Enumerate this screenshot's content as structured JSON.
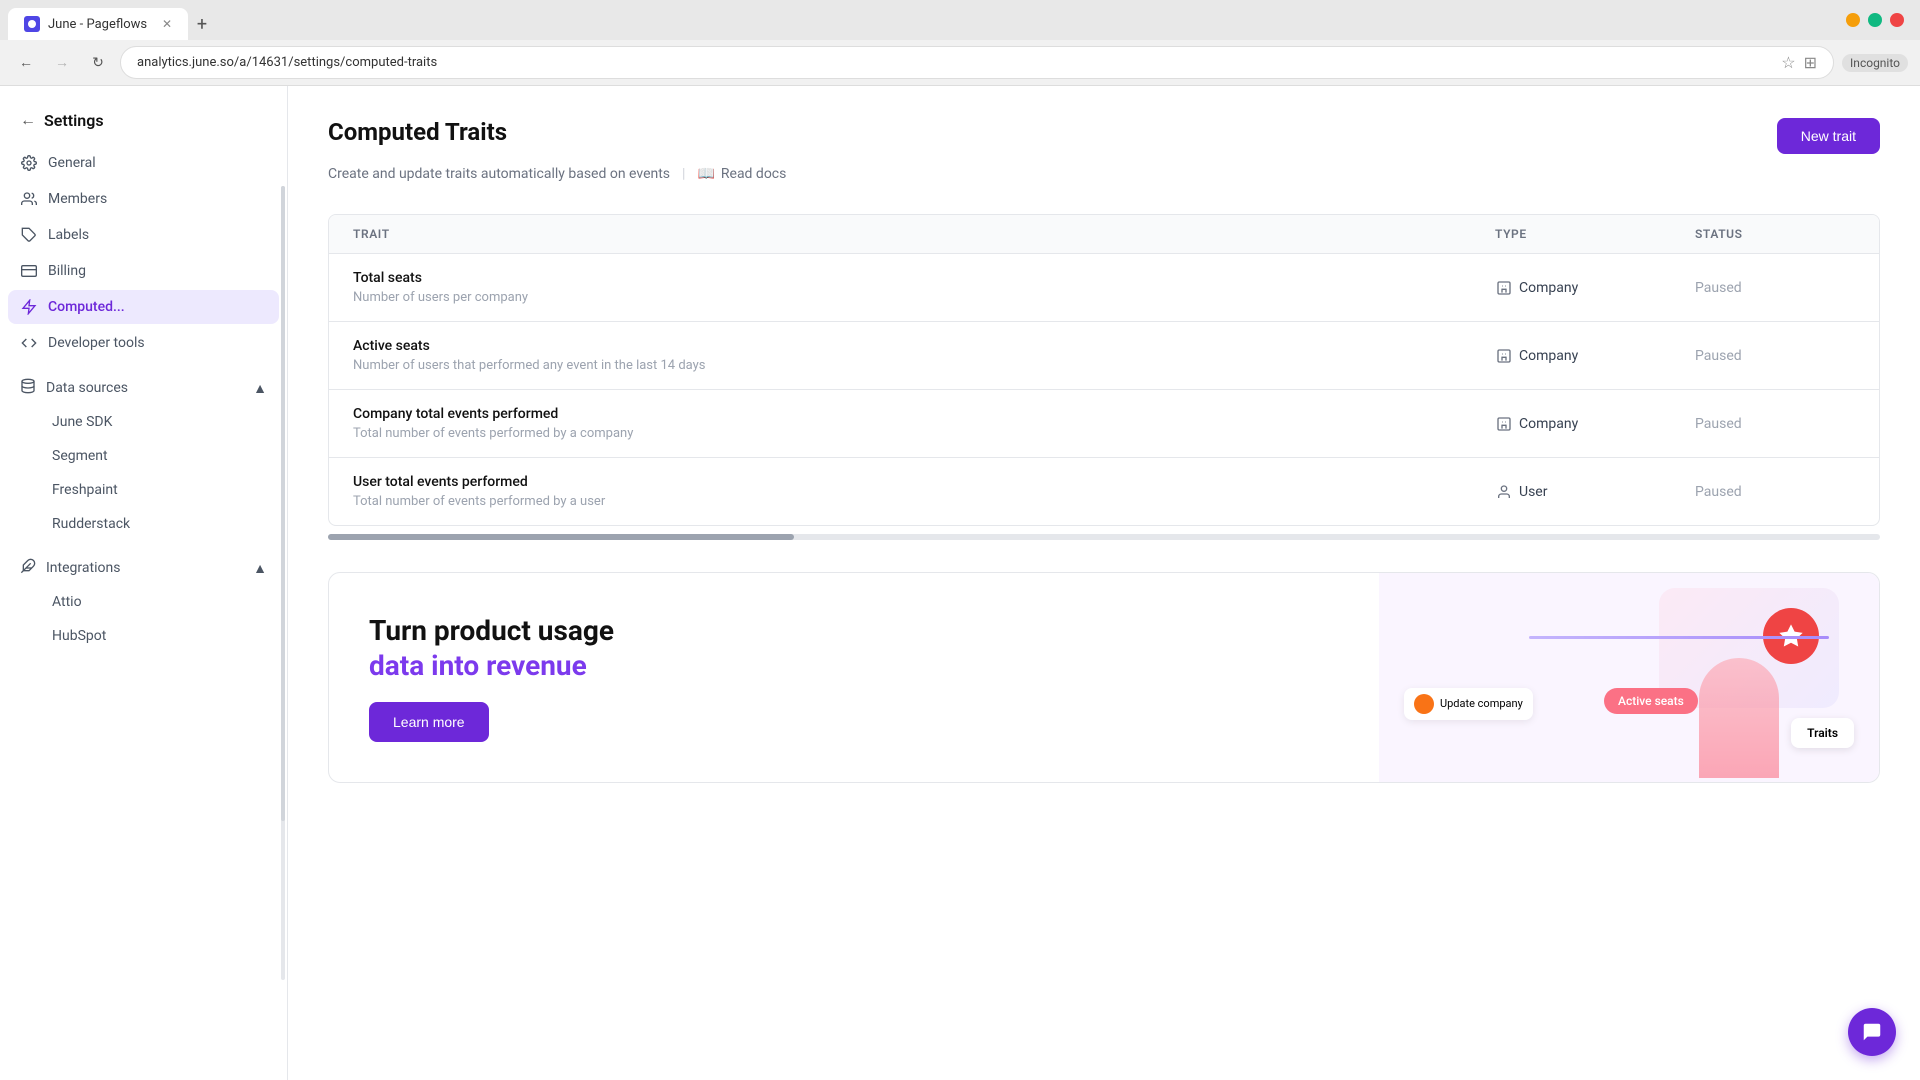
{
  "browser": {
    "tab_title": "June - Pageflows",
    "address": "analytics.june.so/a/14631/settings/computed-traits",
    "incognito": "Incognito"
  },
  "sidebar": {
    "title": "Settings",
    "nav_items": [
      {
        "id": "general",
        "label": "General",
        "icon": "gear"
      },
      {
        "id": "members",
        "label": "Members",
        "icon": "users"
      },
      {
        "id": "labels",
        "label": "Labels",
        "icon": "tag"
      },
      {
        "id": "billing",
        "label": "Billing",
        "icon": "credit-card"
      },
      {
        "id": "computed",
        "label": "Computed...",
        "icon": "bolt",
        "active": true
      },
      {
        "id": "developer",
        "label": "Developer tools",
        "icon": "code"
      }
    ],
    "data_sources": {
      "label": "Data sources",
      "expanded": true,
      "children": [
        "June SDK",
        "Segment",
        "Freshpaint",
        "Rudderstack"
      ]
    },
    "integrations": {
      "label": "Integrations",
      "expanded": true,
      "children": [
        "Attio",
        "HubSpot"
      ]
    }
  },
  "page": {
    "title": "Computed Traits",
    "subtitle": "Create and update traits automatically based on events",
    "read_docs": "Read docs",
    "new_trait_btn": "New trait"
  },
  "table": {
    "headers": [
      "TRAIT",
      "TYPE",
      "STATUS"
    ],
    "rows": [
      {
        "name": "Total seats",
        "description": "Number of users per company",
        "type": "Company",
        "type_icon": "building",
        "status": "Paused"
      },
      {
        "name": "Active seats",
        "description": "Number of users that performed any event in the last 14 days",
        "type": "Company",
        "type_icon": "building",
        "status": "Paused"
      },
      {
        "name": "Company total events performed",
        "description": "Total number of events performed by a company",
        "type": "Company",
        "type_icon": "building",
        "status": "Paused"
      },
      {
        "name": "User total events performed",
        "description": "Total number of events performed by a user",
        "type": "User",
        "type_icon": "user",
        "status": "Paused"
      }
    ]
  },
  "promo": {
    "title": "Turn product usage",
    "subtitle": "data into revenue",
    "learn_more": "Learn more",
    "visual": {
      "update_label": "Update company",
      "active_seats": "Active seats",
      "traits_label": "Traits"
    }
  },
  "chat": {
    "icon": "💬"
  }
}
